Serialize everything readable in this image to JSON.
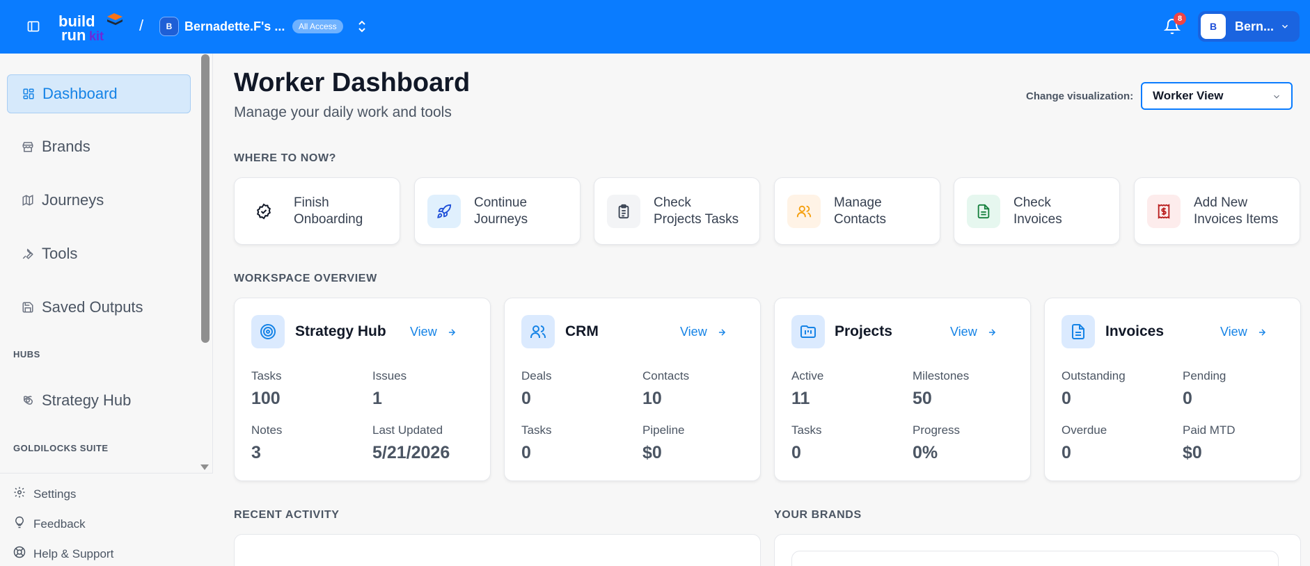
{
  "header": {
    "workspace_initial": "B",
    "workspace_name": "Bernadette.F's ...",
    "access_badge": "All Access",
    "notification_count": "8",
    "user_initial": "B",
    "user_name": "Bern...",
    "brand_color": "#0a7cff"
  },
  "sidebar": {
    "items": [
      {
        "label": "Dashboard",
        "icon": "dashboard-icon",
        "active": true
      },
      {
        "label": "Brands",
        "icon": "store-icon"
      },
      {
        "label": "Journeys",
        "icon": "map-icon"
      },
      {
        "label": "Tools",
        "icon": "wrench-icon"
      },
      {
        "label": "Saved Outputs",
        "icon": "save-icon"
      }
    ],
    "section_hubs": "HUBS",
    "hub_items": [
      {
        "label": "Strategy Hub",
        "icon": "orbit-icon"
      }
    ],
    "section_suite": "GOLDILOCKS SUITE",
    "footer": [
      {
        "label": "Settings",
        "icon": "gear-icon"
      },
      {
        "label": "Feedback",
        "icon": "lightbulb-icon"
      },
      {
        "label": "Help & Support",
        "icon": "lifebuoy-icon"
      }
    ]
  },
  "main": {
    "title": "Worker Dashboard",
    "subtitle": "Manage your daily work and tools",
    "visualization_label": "Change visualization:",
    "visualization_value": "Worker View",
    "where_heading": "WHERE TO NOW?",
    "quick_actions": [
      {
        "line1": "Finish",
        "line2": "Onboarding",
        "icon": "badge-check-icon"
      },
      {
        "line1": "Continue",
        "line2": "Journeys",
        "icon": "rocket-icon"
      },
      {
        "line1": "Check",
        "line2": "Projects Tasks",
        "icon": "clipboard-icon"
      },
      {
        "line1": "Manage",
        "line2": "Contacts",
        "icon": "users-icon"
      },
      {
        "line1": "Check",
        "line2": "Invoices",
        "icon": "file-text-icon"
      },
      {
        "line1": "Add New",
        "line2": "Invoices Items",
        "icon": "receipt-icon"
      }
    ],
    "overview_heading": "WORKSPACE OVERVIEW",
    "overview": [
      {
        "title": "Strategy Hub",
        "view": "View",
        "icon": "target-icon",
        "stats": [
          {
            "label": "Tasks",
            "value": "100"
          },
          {
            "label": "Issues",
            "value": "1"
          },
          {
            "label": "Notes",
            "value": "3"
          },
          {
            "label": "Last Updated",
            "value": "5/21/2026"
          }
        ]
      },
      {
        "title": "CRM",
        "view": "View",
        "icon": "users-icon",
        "stats": [
          {
            "label": "Deals",
            "value": "0"
          },
          {
            "label": "Contacts",
            "value": "10"
          },
          {
            "label": "Tasks",
            "value": "0"
          },
          {
            "label": "Pipeline",
            "value": "$0"
          }
        ]
      },
      {
        "title": "Projects",
        "view": "View",
        "icon": "folder-kanban-icon",
        "stats": [
          {
            "label": "Active",
            "value": "11"
          },
          {
            "label": "Milestones",
            "value": "50"
          },
          {
            "label": "Tasks",
            "value": "0"
          },
          {
            "label": "Progress",
            "value": "0%"
          }
        ]
      },
      {
        "title": "Invoices",
        "view": "View",
        "icon": "file-text-icon",
        "stats": [
          {
            "label": "Outstanding",
            "value": "0"
          },
          {
            "label": "Pending",
            "value": "0"
          },
          {
            "label": "Overdue",
            "value": "0"
          },
          {
            "label": "Paid MTD",
            "value": "$0"
          }
        ]
      }
    ],
    "recent_heading": "RECENT ACTIVITY",
    "brands_heading": "YOUR BRANDS"
  }
}
